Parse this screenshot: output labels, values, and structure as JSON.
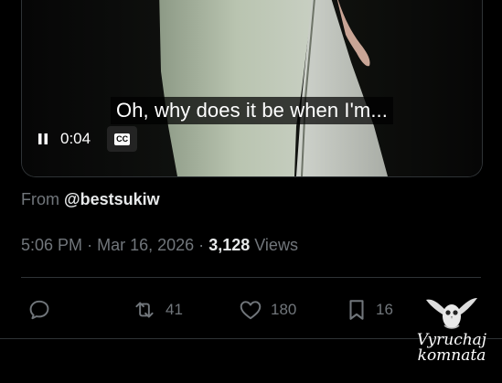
{
  "video": {
    "subtitle": "Oh, why does it be when I'm...",
    "time": "0:04",
    "cc_label": "CC",
    "pause_icon": "pause-icon"
  },
  "post_meta": {
    "from_label": "From",
    "source_handle": "@bestsukiw",
    "time": "5:06 PM",
    "separator": "·",
    "date": "Mar 16, 2026",
    "views_count": "3,128",
    "views_label": "Views"
  },
  "actions": {
    "reply": {
      "icon": "reply-icon",
      "count": ""
    },
    "retweet": {
      "icon": "retweet-icon",
      "count": "41"
    },
    "like": {
      "icon": "heart-icon",
      "count": "180"
    },
    "bookmark": {
      "icon": "bookmark-icon",
      "count": "16"
    }
  },
  "watermark": {
    "line1": "Vyruchaj",
    "line2": "komnata"
  },
  "colors": {
    "background": "#000000",
    "text_primary": "#e7e9ea",
    "text_secondary": "#71767b",
    "border": "#2f3336"
  }
}
